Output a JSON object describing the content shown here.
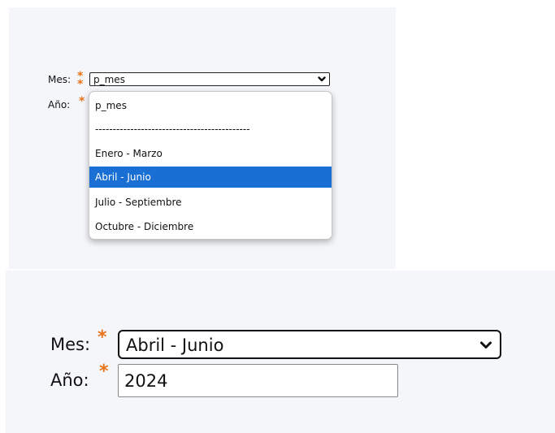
{
  "top_form": {
    "month": {
      "label": "Mes:",
      "required_marker": "*",
      "selected_value": "p_mes",
      "icon": "chevron-down-icon"
    },
    "year": {
      "label": "Año:",
      "required_marker": "*"
    },
    "dropdown": {
      "options": [
        "p_mes",
        "--------------------------------------------",
        "Enero - Marzo",
        "Abril - Junio",
        "Julio - Septiembre",
        "Octubre - Diciembre"
      ],
      "highlighted_option": "Abril - Junio"
    }
  },
  "bottom_form": {
    "month": {
      "label": "Mes:",
      "required_marker": "*",
      "selected_value": "Abril - Junio",
      "icon": "chevron-down-icon"
    },
    "year": {
      "label": "Año:",
      "required_marker": "*",
      "value": "2024"
    }
  },
  "colors": {
    "panel_background": "#f5f6fa",
    "required_marker": "#e8731a",
    "highlight": "#1a6fd4"
  }
}
